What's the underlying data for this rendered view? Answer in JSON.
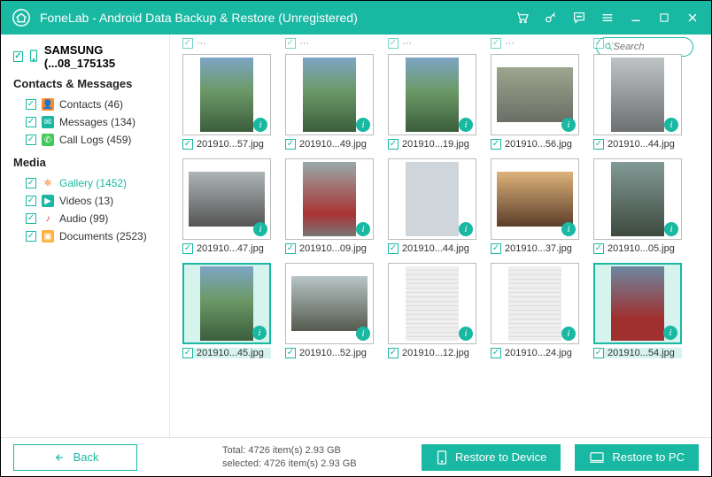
{
  "app": {
    "title": "FoneLab - Android Data Backup & Restore (Unregistered)"
  },
  "search": {
    "placeholder": "Search"
  },
  "device": {
    "name": "SAMSUNG (...08_175135"
  },
  "sidebar": {
    "cat_contacts": "Contacts & Messages",
    "cat_media": "Media",
    "items": [
      {
        "label": "Contacts (46)"
      },
      {
        "label": "Messages (134)"
      },
      {
        "label": "Call Logs (459)"
      },
      {
        "label": "Gallery (1452)"
      },
      {
        "label": "Videos (13)"
      },
      {
        "label": "Audio (99)"
      },
      {
        "label": "Documents (2523)"
      }
    ]
  },
  "grid": [
    [
      {
        "name": "201910...57.jpg"
      },
      {
        "name": "201910...49.jpg"
      },
      {
        "name": "201910...19.jpg"
      },
      {
        "name": "201910...56.jpg"
      },
      {
        "name": "201910...44.jpg"
      }
    ],
    [
      {
        "name": "201910...47.jpg"
      },
      {
        "name": "201910...09.jpg"
      },
      {
        "name": "201910...44.jpg"
      },
      {
        "name": "201910...37.jpg"
      },
      {
        "name": "201910...05.jpg"
      }
    ],
    [
      {
        "name": "201910...45.jpg"
      },
      {
        "name": "201910...52.jpg"
      },
      {
        "name": "201910...12.jpg"
      },
      {
        "name": "201910...24.jpg"
      },
      {
        "name": "201910...54.jpg"
      }
    ]
  ],
  "footer": {
    "back": "Back",
    "total": "Total: 4726 item(s) 2.93 GB",
    "selected": "selected: 4726 item(s) 2.93 GB",
    "restore_device": "Restore to Device",
    "restore_pc": "Restore to PC"
  },
  "colors": {
    "accent": "#19b8a3"
  }
}
